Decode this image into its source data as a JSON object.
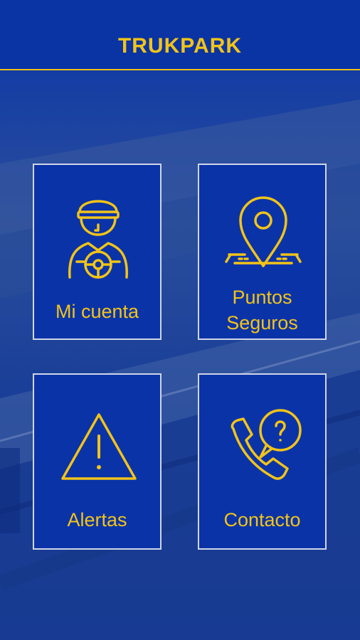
{
  "app": {
    "title": "TRUKPARK"
  },
  "colors": {
    "primary": "#0b35a6",
    "accent": "#f2c417"
  },
  "menu": [
    {
      "label": "Mi cuenta",
      "icon": "driver-icon"
    },
    {
      "label_line1": "Puntos",
      "label_line2": "Seguros",
      "icon": "location-pin-icon"
    },
    {
      "label": "Alertas",
      "icon": "warning-icon"
    },
    {
      "label": "Contacto",
      "icon": "phone-question-icon"
    }
  ]
}
